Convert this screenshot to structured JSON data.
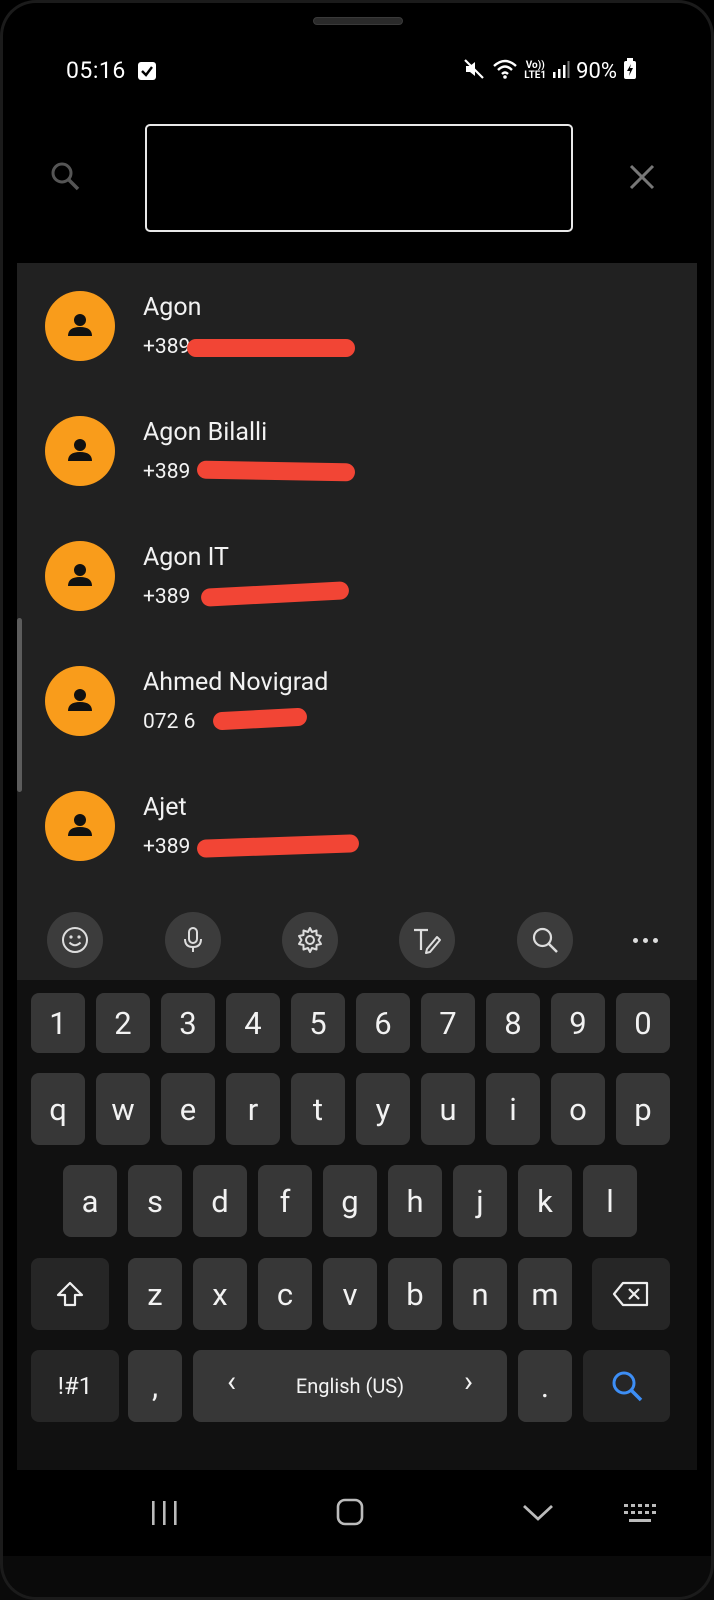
{
  "status_bar": {
    "time": "05:16",
    "battery": "90%",
    "network_label": "Vo)) LTE1"
  },
  "search": {
    "value": "",
    "placeholder": ""
  },
  "contacts": [
    {
      "name": "Agon",
      "phone": "+389"
    },
    {
      "name": "Agon Bilalli",
      "phone": "+389"
    },
    {
      "name": "Agon IT",
      "phone": "+389"
    },
    {
      "name": "Ahmed Novigrad",
      "phone": "072 6"
    },
    {
      "name": "Ajet",
      "phone": "+389"
    }
  ],
  "keyboard": {
    "toolbar_icons": [
      "emoji-icon",
      "microphone-icon",
      "settings-icon",
      "handwriting-icon",
      "search-icon",
      "more-icon"
    ],
    "number_row": [
      "1",
      "2",
      "3",
      "4",
      "5",
      "6",
      "7",
      "8",
      "9",
      "0"
    ],
    "row1": [
      "q",
      "w",
      "e",
      "r",
      "t",
      "y",
      "u",
      "i",
      "o",
      "p"
    ],
    "row2": [
      "a",
      "s",
      "d",
      "f",
      "g",
      "h",
      "j",
      "k",
      "l"
    ],
    "row3": [
      "z",
      "x",
      "c",
      "v",
      "b",
      "n",
      "m"
    ],
    "symbols_label": "!#1",
    "comma": ",",
    "language_label": "English (US)",
    "lang_prev": "‹",
    "lang_next": "›",
    "period": "."
  },
  "colors": {
    "avatar": "#f99c1b",
    "list_bg": "#212121",
    "redaction": "#f24535",
    "search_accent": "#3d8ef5"
  }
}
